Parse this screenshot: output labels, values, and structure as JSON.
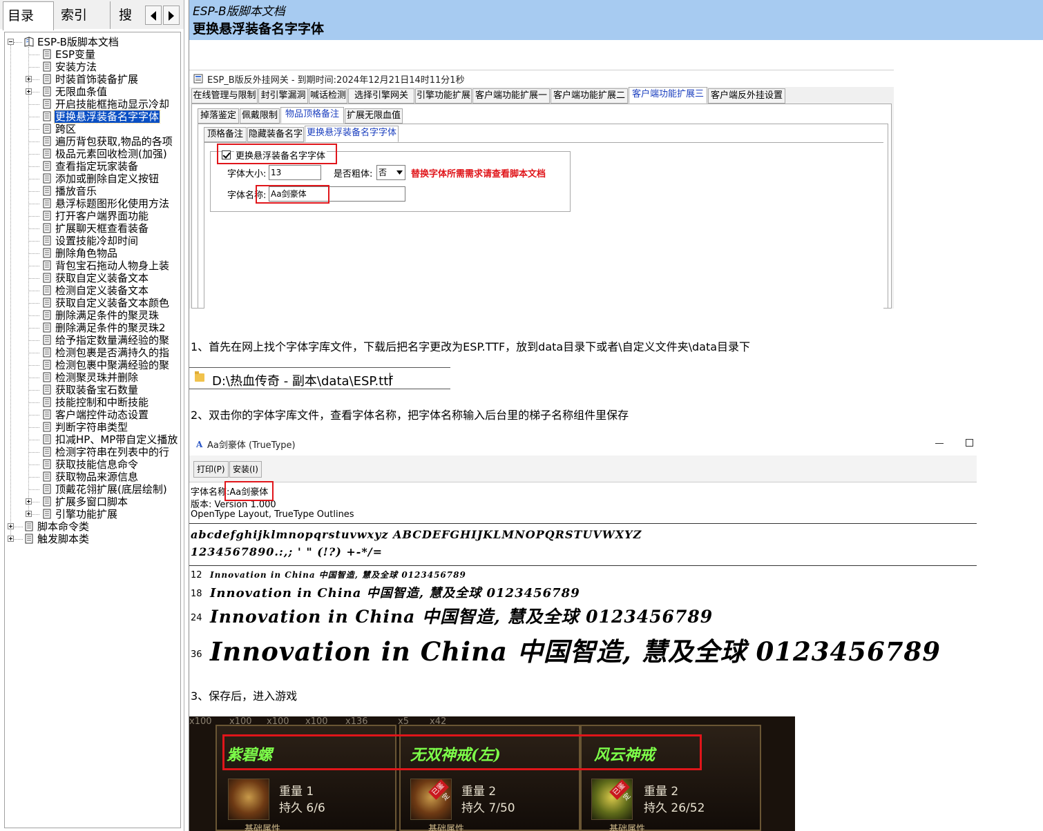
{
  "left_tabs": {
    "contents": "目录(C)",
    "index": "索引(N)",
    "search": "搜索"
  },
  "tree": {
    "root": "ESP-B版脚本文档",
    "items": [
      "ESP变量",
      "安装方法",
      "时装首饰装备扩展",
      "无限血条值",
      "开启技能框拖动显示冷却",
      "更换悬浮装备名字字体",
      "跨区",
      "遍历背包获取,物品的各项",
      "极品元素回收检测(加强)",
      "查看指定玩家装备",
      "添加或删除自定义按钮",
      "播放音乐",
      "悬浮标题图形化使用方法",
      "打开客户端界面功能",
      "扩展聊天框查看装备",
      "设置技能冷却时间",
      "删除角色物品",
      "背包宝石拖动人物身上装",
      "获取自定义装备文本",
      "检测自定义装备文本",
      "获取自定义装备文本颜色",
      "删除满足条件的聚灵珠",
      "删除满足条件的聚灵珠2",
      "给予指定数量满经验的聚",
      "检测包裹是否满持久的指",
      "检测包裹中聚满经验的聚",
      "检测聚灵珠并删除",
      "获取装备宝石数量",
      "技能控制和中断技能",
      "客户端控件动态设置",
      "判断字符串类型",
      "扣减HP、MP带自定义播放",
      "检测字符串在列表中的行",
      "获取技能信息命令",
      "获取物品来源信息",
      "顶戴花翎扩展(底层绘制)",
      "扩展多窗口脚本",
      "引擎功能扩展"
    ],
    "bottom": [
      "脚本命令类",
      "触发脚本类"
    ]
  },
  "header": {
    "doc_title": "ESP-B版脚本文档",
    "topic_title": "更换悬浮装备名字字体"
  },
  "shot1": {
    "window_title": "ESP_B版反外挂网关 - 到期时间:2024年12月21日14时11分1秒",
    "tabs1": [
      "在线管理与限制",
      "封引擎漏洞",
      "喊话检测",
      "选择引擎网关",
      "引擎功能扩展",
      "客户端功能扩展一",
      "客户端功能扩展二",
      "客户端功能扩展三",
      "客户端反外挂设置"
    ],
    "tabs2": [
      "掉落鉴定",
      "佩戴限制",
      "物品顶格备注",
      "扩展无限血值"
    ],
    "tabs3": [
      "顶格备注",
      "隐藏装备名字",
      "更换悬浮装备名字字体"
    ],
    "checkbox_label": "更换悬浮装备名字字体",
    "size_label": "字体大小:",
    "size_value": "13",
    "bold_label": "是否粗体:",
    "bold_value": "否",
    "red_note": "替换字体所需需求请查看脚本文档",
    "name_label": "字体名称:",
    "name_value": "Aa剑豪体"
  },
  "step1": "1、首先在网上找个字体字库文件，下载后把名字更改为ESP.TTF，放到data目录下或者\\自定义文件夹\\data目录下",
  "path_text": "D:\\热血传奇 - 副本\\data\\ESP.ttf",
  "step2": "2、双击你的字体字库文件，查看字体名称，把字体名称输入后台里的梯子名称组件里保存",
  "fontviewer": {
    "title": "Aa剑豪体 (TrueType)",
    "print_btn": "打印(P)",
    "install_btn": "安装(I)",
    "name_label": "字体名称:",
    "name_value": "Aa剑豪体",
    "version": "版本: Version 1.000",
    "layout": "OpenType Layout, TrueType Outlines",
    "alphabet": "abcdefghijklmnopqrstuvwxyz ABCDEFGHIJKLMNOPQRSTUVWXYZ",
    "digits": "1234567890.:,; ' \" (!?) +-*/=",
    "samples": [
      {
        "size": "12",
        "text": "Innovation in China 中国智造, 慧及全球 0123456789"
      },
      {
        "size": "18",
        "text": "Innovation in China 中国智造, 慧及全球 0123456789"
      },
      {
        "size": "24",
        "text": "Innovation in China 中国智造, 慧及全球 0123456789"
      },
      {
        "size": "36",
        "text": "Innovation in China 中国智造, 慧及全球 0123456789"
      }
    ]
  },
  "step3": "3、保存后，进入游戏",
  "game": {
    "counts": [
      "x100",
      "x100",
      "x100",
      "x100",
      "x136",
      "x5",
      "x42"
    ],
    "items": [
      {
        "name": "紫碧螺",
        "weight": "重量  1",
        "dura": "持久  6/6"
      },
      {
        "name": "无双神戒(左)",
        "weight": "重量  2",
        "dura": "持久  7/50"
      },
      {
        "name": "风云神戒",
        "weight": "重量  2",
        "dura": "持久  26/52"
      }
    ],
    "tag": "已鉴定",
    "bottom_label": "基础属性"
  }
}
